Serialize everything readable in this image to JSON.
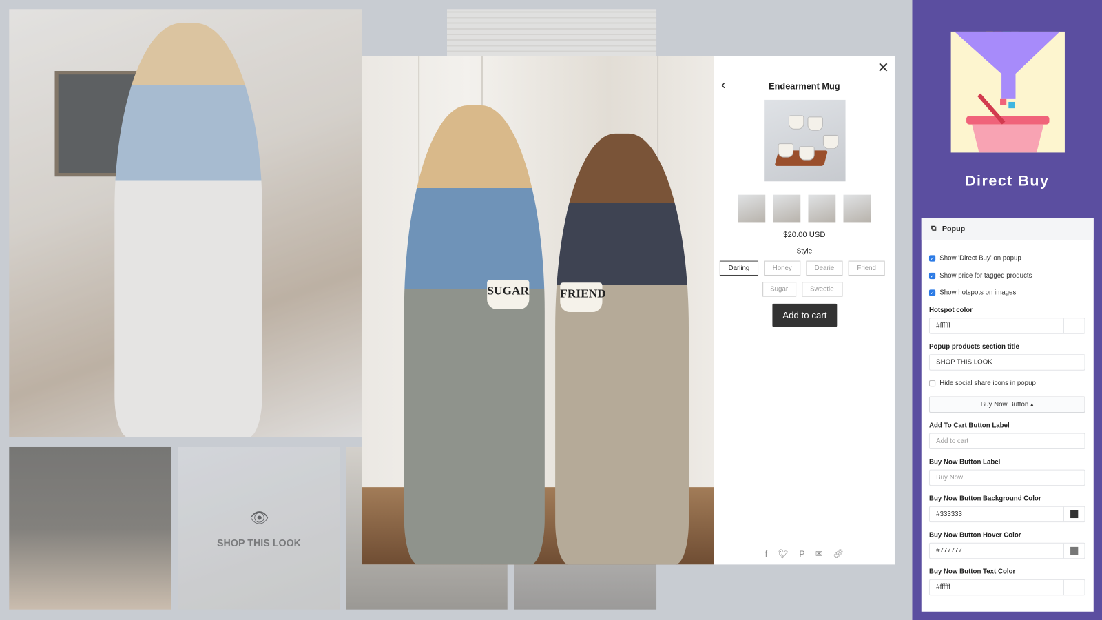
{
  "gallery": {
    "overlay_label": "SHOP THIS LOOK",
    "mug_texts": [
      "SUGAR",
      "FRIEND"
    ]
  },
  "popup": {
    "title": "Endearment Mug",
    "price": "$20.00 USD",
    "style_label": "Style",
    "options": [
      "Darling",
      "Honey",
      "Dearie",
      "Friend",
      "Sugar",
      "Sweetie"
    ],
    "selected_option": "Darling",
    "add_to_cart": "Add to cart",
    "social_icons": [
      "facebook-icon",
      "twitter-icon",
      "pinterest-icon",
      "email-icon",
      "link-icon"
    ]
  },
  "sidebar": {
    "brand": "Direct Buy",
    "brand_color": "#5b4ea0",
    "section_title": "Popup",
    "checkboxes": [
      {
        "label": "Show 'Direct Buy' on popup",
        "checked": true
      },
      {
        "label": "Show price for tagged products",
        "checked": true
      },
      {
        "label": "Show hotspots on images",
        "checked": true
      }
    ],
    "hotspot_color_label": "Hotspot color",
    "hotspot_color": "#ffffff",
    "section_title_label": "Popup products section title",
    "section_title_value": "SHOP THIS LOOK",
    "hide_social": {
      "label": "Hide social share icons in popup",
      "checked": false
    },
    "buy_now_toggle": "Buy Now Button ▴",
    "atc_label_label": "Add To Cart Button Label",
    "atc_label_placeholder": "Add to cart",
    "buy_now_label_label": "Buy Now Button Label",
    "buy_now_label_placeholder": "Buy Now",
    "bg_color_label": "Buy Now Button Background Color",
    "bg_color": "#333333",
    "hover_color_label": "Buy Now Button Hover Color",
    "hover_color": "#777777",
    "text_color_label": "Buy Now Button Text Color",
    "text_color": "#ffffff"
  }
}
